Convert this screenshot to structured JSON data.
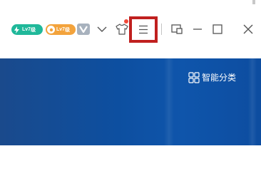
{
  "titlebar": {
    "badges": [
      {
        "label": "Lv7",
        "suffix": "级",
        "color": "#20b89a"
      },
      {
        "label": "Lv7",
        "suffix": "级",
        "color": "#f3a33c"
      }
    ],
    "icons": {
      "vip": "vip-icon",
      "expand": "chevron-down-icon",
      "skin": "shirt-icon",
      "menu": "hamburger-menu-icon",
      "mini_mode": "mini-window-icon",
      "minimize": "minimize-icon",
      "maximize": "maximize-icon",
      "close": "close-icon"
    },
    "colors": {
      "highlight_border": "#c0201f",
      "notification_dot": "#f04a3a",
      "content_bg": "#0d4fa0"
    }
  },
  "content": {
    "smart_category_label": "智能分类"
  }
}
